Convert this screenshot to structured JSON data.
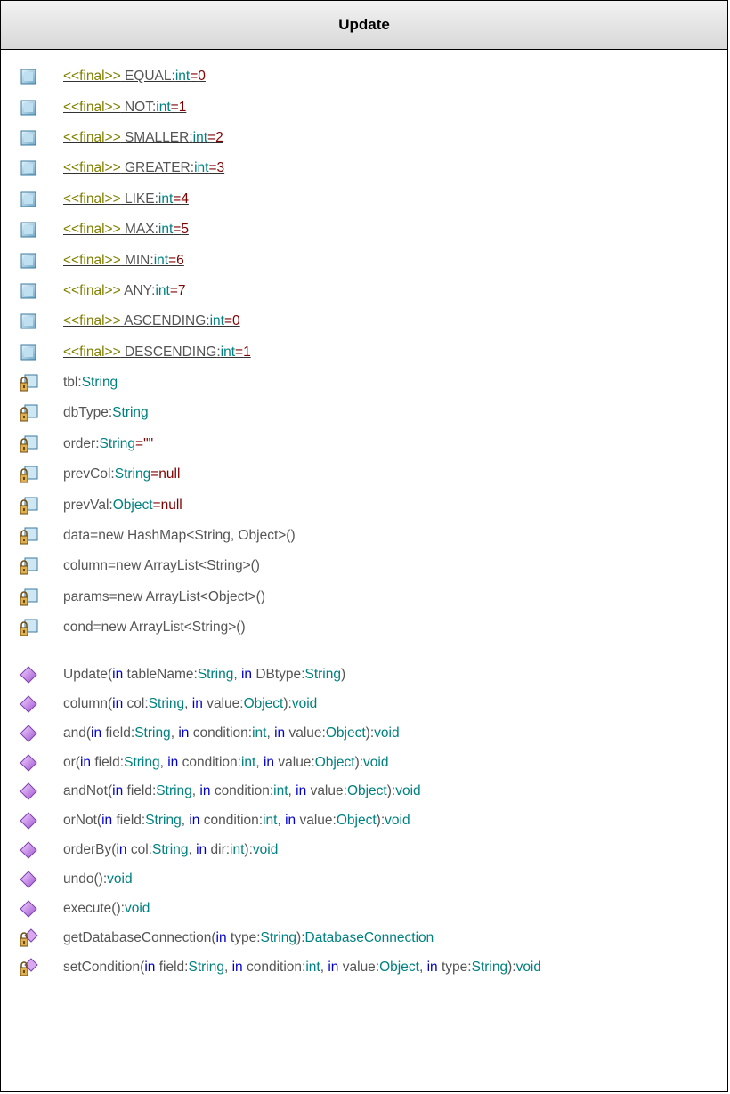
{
  "class_name": "Update",
  "attributes": [
    {
      "kind": "static",
      "icon": "static-field-icon",
      "stereotype": "<<final>>",
      "name": "EQUAL",
      "sep": ":",
      "type": "int",
      "eq": "=",
      "value": "0"
    },
    {
      "kind": "static",
      "icon": "static-field-icon",
      "stereotype": "<<final>>",
      "name": "NOT",
      "sep": ":",
      "type": "int",
      "eq": "=",
      "value": "1"
    },
    {
      "kind": "static",
      "icon": "static-field-icon",
      "stereotype": "<<final>>",
      "name": "SMALLER",
      "sep": ":",
      "type": "int",
      "eq": "=",
      "value": "2"
    },
    {
      "kind": "static",
      "icon": "static-field-icon",
      "stereotype": "<<final>>",
      "name": "GREATER",
      "sep": ":",
      "type": "int",
      "eq": "=",
      "value": "3"
    },
    {
      "kind": "static",
      "icon": "static-field-icon",
      "stereotype": "<<final>>",
      "name": "LIKE",
      "sep": ":",
      "type": "int",
      "eq": "=",
      "value": "4"
    },
    {
      "kind": "static",
      "icon": "static-field-icon",
      "stereotype": "<<final>>",
      "name": "MAX",
      "sep": ":",
      "type": "int",
      "eq": "=",
      "value": "5"
    },
    {
      "kind": "static",
      "icon": "static-field-icon",
      "stereotype": "<<final>>",
      "name": "MIN",
      "sep": ":",
      "type": "int",
      "eq": "=",
      "value": "6"
    },
    {
      "kind": "static",
      "icon": "static-field-icon",
      "stereotype": "<<final>>",
      "name": "ANY",
      "sep": ":",
      "type": "int",
      "eq": "=",
      "value": "7"
    },
    {
      "kind": "static",
      "icon": "static-field-icon",
      "stereotype": "<<final>>",
      "name": "ASCENDING",
      "sep": ":",
      "type": "int",
      "eq": "=",
      "value": "0"
    },
    {
      "kind": "static",
      "icon": "static-field-icon",
      "stereotype": "<<final>>",
      "name": "DESCENDING",
      "sep": ":",
      "type": "int",
      "eq": "=",
      "value": "1"
    },
    {
      "kind": "private",
      "icon": "private-field-lock-icon",
      "stereotype": "",
      "name": "tbl",
      "sep": ":",
      "type": "String",
      "eq": "",
      "value": ""
    },
    {
      "kind": "private",
      "icon": "private-field-lock-icon",
      "stereotype": "",
      "name": "dbType",
      "sep": ":",
      "type": "String",
      "eq": "",
      "value": ""
    },
    {
      "kind": "private",
      "icon": "private-field-lock-icon",
      "stereotype": "",
      "name": "order",
      "sep": ":",
      "type": "String",
      "eq": "=",
      "value": "\"\""
    },
    {
      "kind": "private",
      "icon": "private-field-lock-icon",
      "stereotype": "",
      "name": "prevCol",
      "sep": ":",
      "type": "String",
      "eq": "=",
      "value": "null"
    },
    {
      "kind": "private",
      "icon": "private-field-lock-icon",
      "stereotype": "",
      "name": "prevVal",
      "sep": ":",
      "type": "Object",
      "eq": "=",
      "value": "null"
    },
    {
      "kind": "private",
      "icon": "private-field-lock-icon",
      "stereotype": "",
      "name": "data=new HashMap<String, Object>()",
      "sep": "",
      "type": "",
      "eq": "",
      "value": ""
    },
    {
      "kind": "private",
      "icon": "private-field-lock-icon",
      "stereotype": "",
      "name": "column=new ArrayList<String>()",
      "sep": "",
      "type": "",
      "eq": "",
      "value": ""
    },
    {
      "kind": "private",
      "icon": "private-field-lock-icon",
      "stereotype": "",
      "name": "params=new ArrayList<Object>()",
      "sep": "",
      "type": "",
      "eq": "",
      "value": ""
    },
    {
      "kind": "private",
      "icon": "private-field-lock-icon",
      "stereotype": "",
      "name": "cond=new ArrayList<String>()",
      "sep": "",
      "type": "",
      "eq": "",
      "value": ""
    }
  ],
  "operations": [
    {
      "visibility": "public",
      "icon": "public-method-icon",
      "name": "Update",
      "params": [
        {
          "dir": "in",
          "name": "tableName",
          "type": "String"
        },
        {
          "dir": "in",
          "name": "DBtype",
          "type": "String"
        }
      ],
      "ret": ""
    },
    {
      "visibility": "public",
      "icon": "public-method-icon",
      "name": "column",
      "params": [
        {
          "dir": "in",
          "name": "col",
          "type": "String"
        },
        {
          "dir": "in",
          "name": "value",
          "type": "Object"
        }
      ],
      "ret": "void"
    },
    {
      "visibility": "public",
      "icon": "public-method-icon",
      "name": "and",
      "params": [
        {
          "dir": "in",
          "name": "field",
          "type": "String"
        },
        {
          "dir": "in",
          "name": "condition",
          "type": "int"
        },
        {
          "dir": "in",
          "name": "value",
          "type": "Object"
        }
      ],
      "ret": "void"
    },
    {
      "visibility": "public",
      "icon": "public-method-icon",
      "name": "or",
      "params": [
        {
          "dir": "in",
          "name": "field",
          "type": "String"
        },
        {
          "dir": "in",
          "name": "condition",
          "type": "int"
        },
        {
          "dir": "in",
          "name": "value",
          "type": "Object"
        }
      ],
      "ret": "void"
    },
    {
      "visibility": "public",
      "icon": "public-method-icon",
      "name": "andNot",
      "params": [
        {
          "dir": "in",
          "name": "field",
          "type": "String"
        },
        {
          "dir": "in",
          "name": "condition",
          "type": "int"
        },
        {
          "dir": "in",
          "name": "value",
          "type": "Object"
        }
      ],
      "ret": "void"
    },
    {
      "visibility": "public",
      "icon": "public-method-icon",
      "name": "orNot",
      "params": [
        {
          "dir": "in",
          "name": "field",
          "type": "String"
        },
        {
          "dir": "in",
          "name": "condition",
          "type": "int"
        },
        {
          "dir": "in",
          "name": "value",
          "type": "Object"
        }
      ],
      "ret": "void"
    },
    {
      "visibility": "public",
      "icon": "public-method-icon",
      "name": "orderBy",
      "params": [
        {
          "dir": "in",
          "name": "col",
          "type": "String"
        },
        {
          "dir": "in",
          "name": "dir",
          "type": "int"
        }
      ],
      "ret": "void"
    },
    {
      "visibility": "public",
      "icon": "public-method-icon",
      "name": "undo",
      "params": [],
      "ret": "void"
    },
    {
      "visibility": "public",
      "icon": "public-method-icon",
      "name": "execute",
      "params": [],
      "ret": "void"
    },
    {
      "visibility": "private",
      "icon": "private-method-lock-icon",
      "name": "getDatabaseConnection",
      "params": [
        {
          "dir": "in",
          "name": "type",
          "type": "String"
        }
      ],
      "ret": "DatabaseConnection"
    },
    {
      "visibility": "private",
      "icon": "private-method-lock-icon",
      "name": "setCondition",
      "params": [
        {
          "dir": "in",
          "name": "field",
          "type": "String"
        },
        {
          "dir": "in",
          "name": "condition",
          "type": "int"
        },
        {
          "dir": "in",
          "name": "value",
          "type": "Object"
        },
        {
          "dir": "in",
          "name": "type",
          "type": "String"
        }
      ],
      "ret": "void"
    }
  ],
  "colors": {
    "text": "#555555",
    "type": "#008080",
    "value": "#800000",
    "stereotype": "#808000",
    "keyword": "#0000cc",
    "method_icon": "#c080e0",
    "lock_icon": "#c8a040"
  }
}
